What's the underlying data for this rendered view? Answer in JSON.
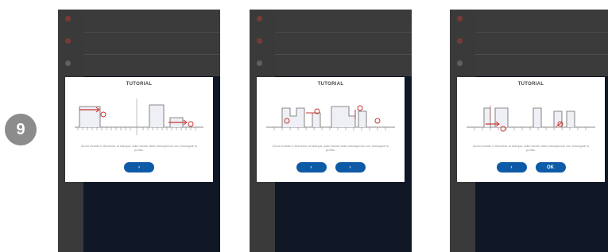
{
  "step_number": "9",
  "screens": [
    {
      "title": "TUTORIAL",
      "description": "Zoom mobile e direzione di stampa, sulle tavole dello smartphone con immagine in profilo.",
      "buttons": [
        {
          "label": "›",
          "icon": "chevron-right-icon"
        }
      ]
    },
    {
      "title": "TUTORIAL",
      "description": "Zoom mobile e direzione di stampa, sulle tavole dello smartphone con immagine in profilo.",
      "buttons": [
        {
          "label": "‹",
          "icon": "chevron-left-icon"
        },
        {
          "label": "›",
          "icon": "chevron-right-icon"
        }
      ]
    },
    {
      "title": "TUTORIAL",
      "description": "Zoom mobile e direzione di stampa, sulle tavole dello smartphone con immagine in profilo.",
      "buttons": [
        {
          "label": "‹",
          "icon": "chevron-left-icon"
        },
        {
          "label": "OK",
          "icon": ""
        }
      ]
    }
  ],
  "colors": {
    "badge": "#8c8c8c",
    "phone_bg": "#101828",
    "button": "#0d5aa7",
    "accent_red": "#c8332c"
  }
}
